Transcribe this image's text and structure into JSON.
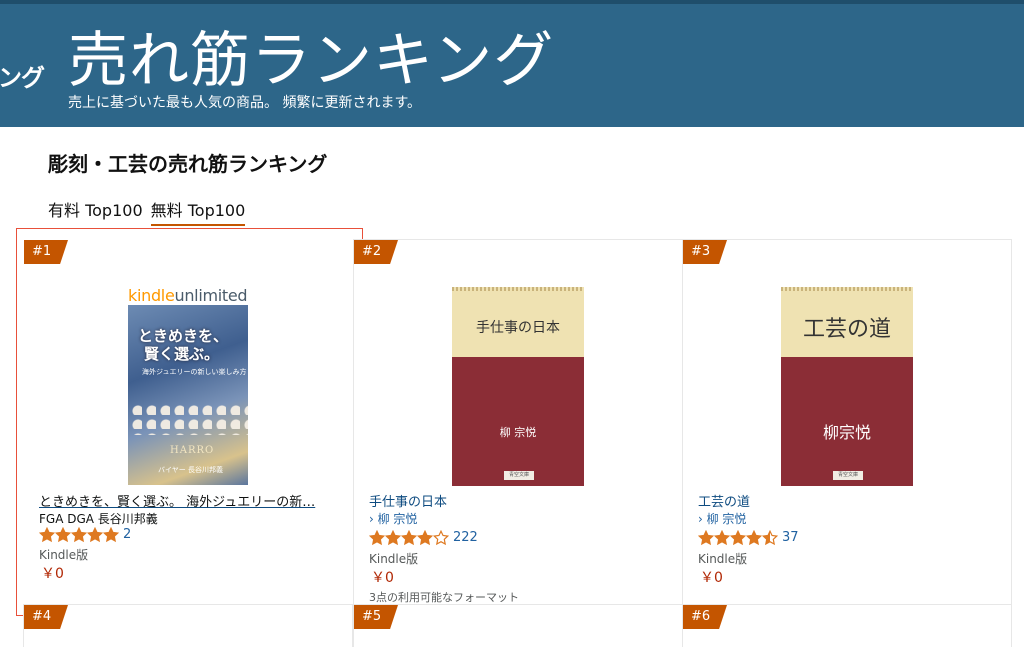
{
  "banner": {
    "side_text": "ング",
    "title": "売れ筋ランキング",
    "subtitle": "売上に基づいた最も人気の商品。 頻繁に更新されます。"
  },
  "category_title": "彫刻・工芸の売れ筋ランキング",
  "tabs": [
    {
      "label": "有料 Top100",
      "active": false
    },
    {
      "label": "無料 Top100",
      "active": true
    }
  ],
  "items": [
    {
      "rank": "#1",
      "title": "ときめきを、賢く選ぶ。 海外ジュエリーの新…",
      "author": "FGA DGA 長谷川邦義",
      "rating": 5,
      "rating_count": "2",
      "format": "Kindle版",
      "price": "￥0",
      "selected": true,
      "cover": {
        "logo_kindle": "kindle",
        "logo_unlimited": "unlimited",
        "line1": "ときめきを、",
        "line2": "賢く選ぶ。",
        "tagline": "海外ジュエリーの新しい楽しみ方",
        "brand": "HARRO",
        "byline": "バイヤー 長谷川邦義"
      }
    },
    {
      "rank": "#2",
      "title": "手仕事の日本",
      "author": "› 柳 宗悦",
      "rating": 4,
      "rating_count": "222",
      "format": "Kindle版",
      "price": "￥0",
      "formats_note": "3点の利用可能なフォーマット",
      "cover": {
        "title": "手仕事の日本",
        "author": "柳 宗悦",
        "publisher": "青空文庫"
      }
    },
    {
      "rank": "#3",
      "title": "工芸の道",
      "author": "› 柳 宗悦",
      "rating": 4.5,
      "rating_count": "37",
      "format": "Kindle版",
      "price": "￥0",
      "cover": {
        "title": "工芸の道",
        "author": "柳宗悦",
        "publisher": "青空文庫"
      }
    },
    {
      "rank": "#4"
    },
    {
      "rank": "#5"
    },
    {
      "rank": "#6"
    }
  ],
  "colors": {
    "banner": "#2d6689",
    "badge": "#c45500",
    "star": "#de7921",
    "price": "#b12704",
    "link": "#2162a1",
    "selection": "#e8503a"
  }
}
